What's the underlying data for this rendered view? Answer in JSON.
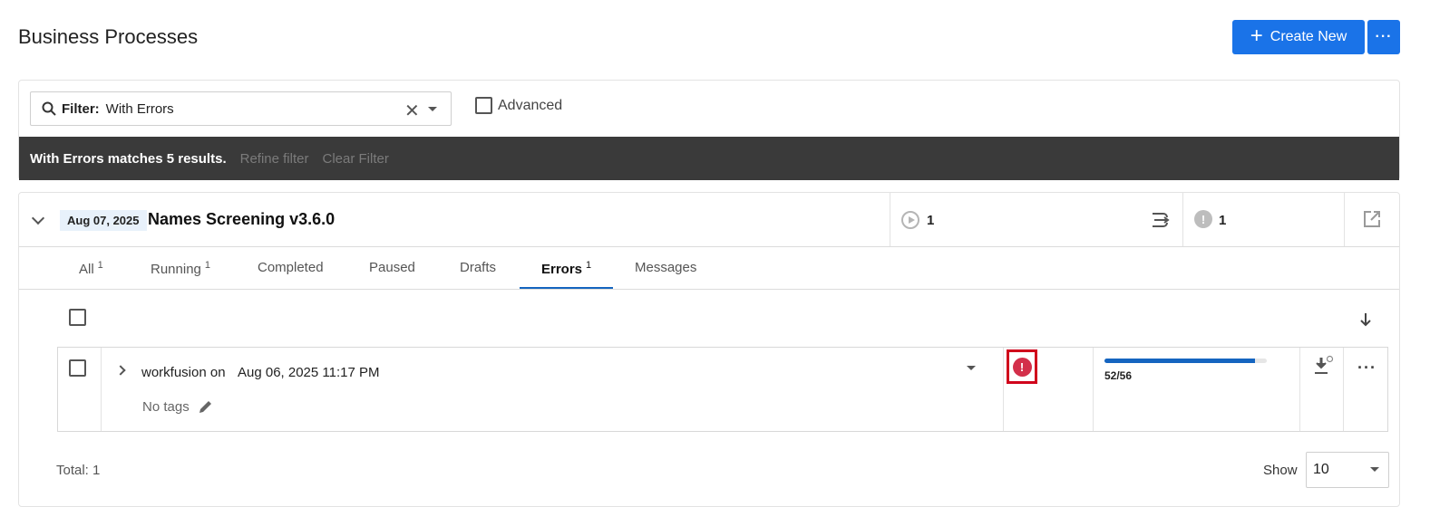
{
  "header": {
    "title": "Business Processes",
    "create_label": "Create New",
    "create_icon": "plus-icon",
    "more_label": "···"
  },
  "filter": {
    "label": "Filter:",
    "value": "With Errors",
    "advanced_label": "Advanced",
    "results_message": "With Errors matches 5 results.",
    "refine_label": "Refine filter",
    "clear_label": "Clear Filter"
  },
  "process": {
    "date": "Aug 07, 2025",
    "name": "Names Screening v3.6.0",
    "running_count": "1",
    "error_count": "1"
  },
  "tabs": [
    {
      "label": "All",
      "count": "1"
    },
    {
      "label": "Running",
      "count": "1"
    },
    {
      "label": "Completed",
      "count": ""
    },
    {
      "label": "Paused",
      "count": ""
    },
    {
      "label": "Drafts",
      "count": ""
    },
    {
      "label": "Errors",
      "count": "1",
      "active": true
    },
    {
      "label": "Messages",
      "count": ""
    }
  ],
  "row": {
    "user": "workfusion on",
    "date": "Aug 06, 2025 11:17 PM",
    "tags": "No tags",
    "progress_label": "52/56",
    "progress_fraction": 0.9286,
    "status_icon": "error-icon"
  },
  "footer": {
    "total": "Total: 1",
    "show_label": "Show",
    "page_size": "10"
  },
  "colors": {
    "primary": "#1a73e8",
    "error": "#d32f4a",
    "results_bar": "#3a3a3a",
    "progress": "#1565c0"
  }
}
